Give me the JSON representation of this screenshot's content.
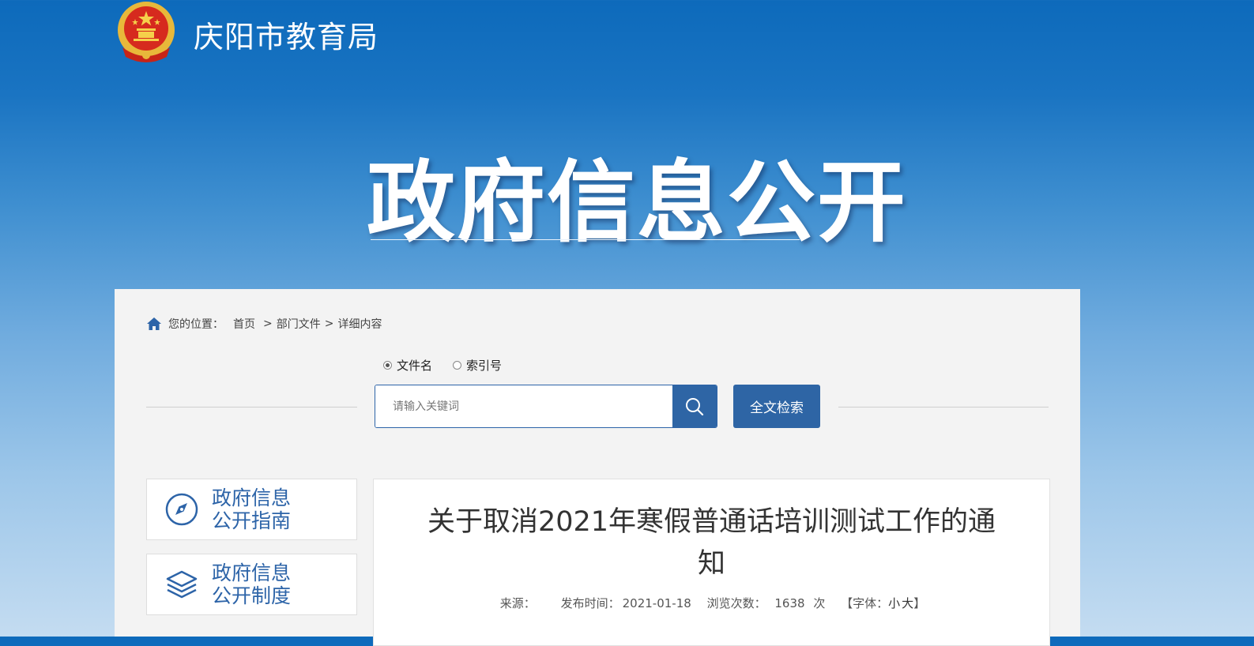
{
  "site": {
    "name": "庆阳市教育局"
  },
  "hero": {
    "title": "政府信息公开"
  },
  "breadcrumb": {
    "prefix": "您的位置：",
    "items": [
      "首页",
      "部门文件",
      "详细内容"
    ],
    "separator": ">"
  },
  "search": {
    "types": [
      {
        "label": "文件名",
        "selected": true
      },
      {
        "label": "索引号",
        "selected": false
      }
    ],
    "placeholder": "请输入关键词",
    "fulltext_label": "全文检索"
  },
  "sidebar": {
    "items": [
      {
        "line1": "政府信息",
        "line2": "公开指南",
        "icon": "compass-icon"
      },
      {
        "line1": "政府信息",
        "line2": "公开制度",
        "icon": "layers-icon"
      }
    ]
  },
  "article": {
    "title": "关于取消2021年寒假普通话培训测试工作的通知",
    "source_label": "来源：",
    "source_value": "",
    "date_label": "发布时间：",
    "date_value": "2021-01-18",
    "views_label": "浏览次数：",
    "views_value": "1638",
    "views_unit": "次",
    "font_open": "【字体：",
    "font_small": "小",
    "font_large": "大",
    "font_close": "】"
  },
  "colors": {
    "accent": "#2e65a5",
    "link_blue": "#2d64a8"
  }
}
